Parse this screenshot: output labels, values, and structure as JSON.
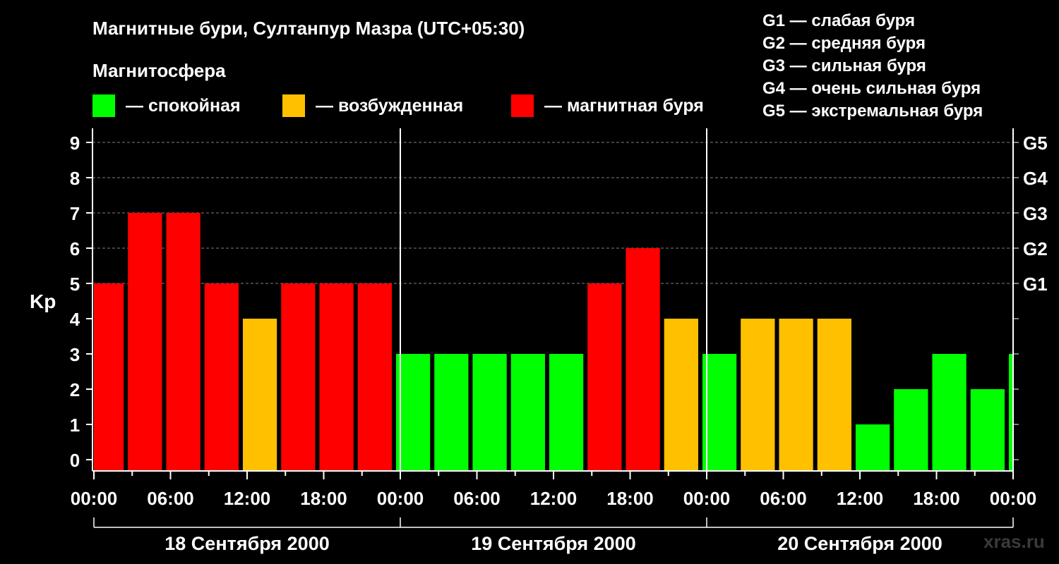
{
  "header": {
    "title": "Магнитные бури, Султанпур Мазра (UTC+05:30)",
    "legend_heading": "Магнитосфера"
  },
  "legend": [
    {
      "label": "— спокойная",
      "color": "#00ff00"
    },
    {
      "label": "— возбужденная",
      "color": "#ffc000"
    },
    {
      "label": "— магнитная буря",
      "color": "#ff0000"
    }
  ],
  "storm_scale": [
    "G1 — слабая буря",
    "G2 — средняя буря",
    "G3 — сильная буря",
    "G4 — очень сильная буря",
    "G5 — экстремальная буря"
  ],
  "watermark": "xras.ru",
  "colors": {
    "quiet": "#00ff00",
    "active": "#ffc000",
    "storm": "#ff0000",
    "background": "#000000",
    "axis": "#ffffff",
    "grid": "#808080"
  },
  "chart_data": {
    "type": "bar",
    "title": "Магнитные бури, Султанпур Мазра (UTC+05:30)",
    "ylabel": "Kp",
    "ylim": [
      0,
      9
    ],
    "yticks": [
      "0",
      "1",
      "2",
      "3",
      "4",
      "5",
      "6",
      "7",
      "8",
      "9"
    ],
    "right_ticks": [
      {
        "kp": 5,
        "label": "G1"
      },
      {
        "kp": 6,
        "label": "G2"
      },
      {
        "kp": 7,
        "label": "G3"
      },
      {
        "kp": 8,
        "label": "G4"
      },
      {
        "kp": 9,
        "label": "G5"
      }
    ],
    "grid": true,
    "x_tick_labels": [
      "00:00",
      "06:00",
      "12:00",
      "18:00",
      "00:00",
      "06:00",
      "12:00",
      "18:00",
      "00:00",
      "06:00",
      "12:00",
      "18:00",
      "00:00"
    ],
    "days": [
      "18 Сентября 2000",
      "19 Сентября 2000",
      "20 Сентября 2000"
    ],
    "bars": [
      {
        "start": "2000-09-18 00:00",
        "kp": 5,
        "level": "storm"
      },
      {
        "start": "2000-09-18 02:30",
        "kp": 7,
        "level": "storm"
      },
      {
        "start": "2000-09-18 05:30",
        "kp": 7,
        "level": "storm"
      },
      {
        "start": "2000-09-18 08:30",
        "kp": 5,
        "level": "storm"
      },
      {
        "start": "2000-09-18 11:30",
        "kp": 4,
        "level": "active"
      },
      {
        "start": "2000-09-18 14:30",
        "kp": 5,
        "level": "storm"
      },
      {
        "start": "2000-09-18 17:30",
        "kp": 5,
        "level": "storm"
      },
      {
        "start": "2000-09-18 20:30",
        "kp": 5,
        "level": "storm"
      },
      {
        "start": "2000-09-18 23:30",
        "kp": 3,
        "level": "quiet"
      },
      {
        "start": "2000-09-19 02:30",
        "kp": 3,
        "level": "quiet"
      },
      {
        "start": "2000-09-19 05:30",
        "kp": 3,
        "level": "quiet"
      },
      {
        "start": "2000-09-19 08:30",
        "kp": 3,
        "level": "quiet"
      },
      {
        "start": "2000-09-19 11:30",
        "kp": 3,
        "level": "quiet"
      },
      {
        "start": "2000-09-19 14:30",
        "kp": 5,
        "level": "storm"
      },
      {
        "start": "2000-09-19 17:30",
        "kp": 6,
        "level": "storm"
      },
      {
        "start": "2000-09-19 20:30",
        "kp": 4,
        "level": "active"
      },
      {
        "start": "2000-09-19 23:30",
        "kp": 3,
        "level": "quiet"
      },
      {
        "start": "2000-09-20 02:30",
        "kp": 4,
        "level": "active"
      },
      {
        "start": "2000-09-20 05:30",
        "kp": 4,
        "level": "active"
      },
      {
        "start": "2000-09-20 08:30",
        "kp": 4,
        "level": "active"
      },
      {
        "start": "2000-09-20 11:30",
        "kp": 1,
        "level": "quiet"
      },
      {
        "start": "2000-09-20 14:30",
        "kp": 2,
        "level": "quiet"
      },
      {
        "start": "2000-09-20 17:30",
        "kp": 3,
        "level": "quiet"
      },
      {
        "start": "2000-09-20 20:30",
        "kp": 2,
        "level": "quiet"
      },
      {
        "start": "2000-09-20 23:30",
        "kp": 3,
        "level": "quiet"
      }
    ]
  }
}
